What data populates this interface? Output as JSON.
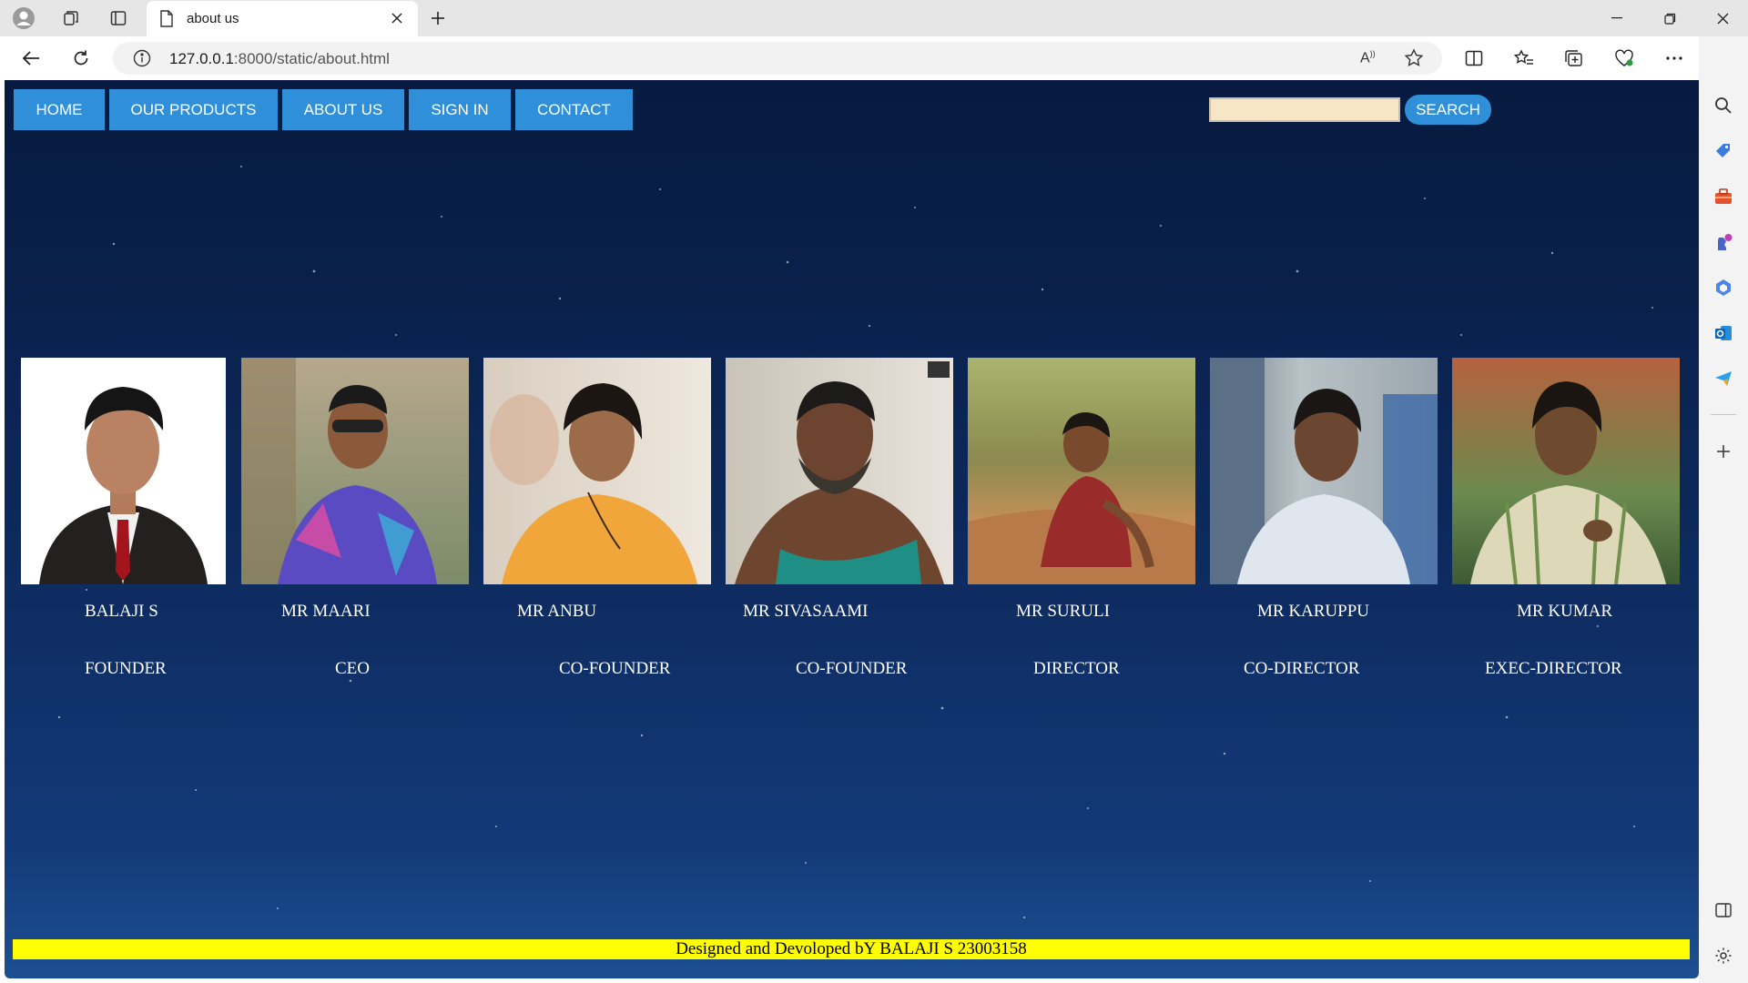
{
  "browser": {
    "tab_title": "about us",
    "url_host": "127.0.0.1",
    "url_path": ":8000/static/about.html"
  },
  "page": {
    "nav": [
      {
        "label": "HOME"
      },
      {
        "label": "OUR PRODUCTS"
      },
      {
        "label": "ABOUT US"
      },
      {
        "label": "SIGN IN"
      },
      {
        "label": "CONTACT"
      }
    ],
    "search": {
      "value": "",
      "button_label": "SEARCH"
    },
    "team": [
      {
        "name": "BALAJI S",
        "role": "FOUNDER"
      },
      {
        "name": "MR MAARI",
        "role": "CEO"
      },
      {
        "name": "MR ANBU",
        "role": "CO-FOUNDER"
      },
      {
        "name": "MR SIVASAAMI",
        "role": "CO-FOUNDER"
      },
      {
        "name": "MR SURULI",
        "role": "DIRECTOR"
      },
      {
        "name": "MR KARUPPU",
        "role": "CO-DIRECTOR"
      },
      {
        "name": "MR KUMAR",
        "role": "EXEC-DIRECTOR"
      }
    ],
    "footer": "Designed and Devoloped bY BALAJI S 23003158"
  },
  "colors": {
    "menu_bg": "#2f8fd8",
    "footer_bg": "#ffff00",
    "page_bg_top": "#071a3f",
    "page_bg_bottom": "#1c4f92"
  }
}
